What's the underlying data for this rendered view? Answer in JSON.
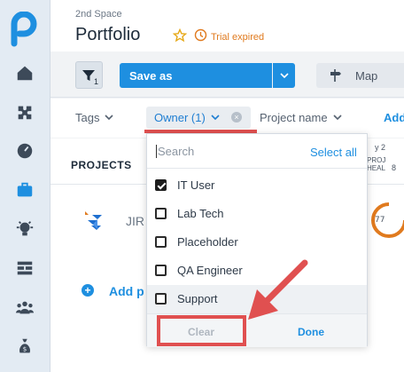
{
  "header": {
    "space_name": "2nd Space",
    "title": "Portfolio",
    "trial_status": "Trial expired"
  },
  "toolbar": {
    "filter_count": "1",
    "save_as_label": "Save as",
    "map_label": "Map"
  },
  "filters": {
    "tags_label": "Tags",
    "owner_label": "Owner (1)",
    "project_name_label": "Project name",
    "add_label": "Add"
  },
  "content": {
    "projects_header": "PROJECTS",
    "project_name_partial": "JIR",
    "add_project_partial": "Add p",
    "col_top": "y 2",
    "col_text_1": "PROJ",
    "col_text_2": "HEAL",
    "col_num": "8",
    "gauge_value": "77"
  },
  "dropdown": {
    "search_placeholder": "Search",
    "select_all": "Select all",
    "options": [
      {
        "label": "IT User",
        "checked": true
      },
      {
        "label": "Lab Tech",
        "checked": false
      },
      {
        "label": "Placeholder",
        "checked": false
      },
      {
        "label": "QA Engineer",
        "checked": false
      },
      {
        "label": "Support",
        "checked": false
      }
    ],
    "clear_label": "Clear",
    "done_label": "Done"
  },
  "colors": {
    "accent": "#1e8fe0",
    "annotation": "#e05050",
    "trial": "#e07a1e"
  }
}
